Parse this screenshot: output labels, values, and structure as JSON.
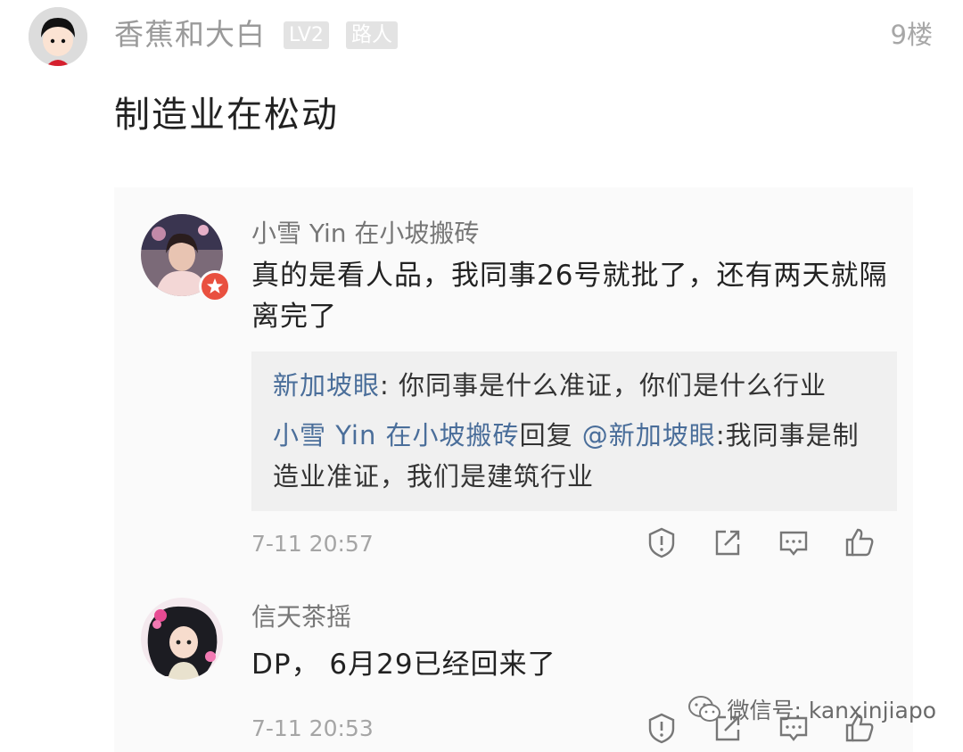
{
  "post": {
    "username": "香蕉和大白",
    "level_badge": "LV2",
    "role_badge": "路人",
    "floor": "9楼",
    "body": "制造业在松动"
  },
  "comments": [
    {
      "author": "小雪 Yin 在小坡搬砖",
      "text": "真的是看人品，我同事26号就批了，还有两天就隔离完了",
      "quote": {
        "line1_author": "新加坡眼",
        "line1_text": ": 你同事是什么准证，你们是什么行业",
        "line2_author": "小雪 Yin 在小坡搬砖",
        "line2_verb": "回复",
        "line2_mention": "@新加坡眼",
        "line2_text": ":我同事是制",
        "line3_text": "造业准证，我们是建筑行业"
      },
      "time": "7-11 20:57"
    },
    {
      "author": "信天茶摇",
      "text": "DP， 6月29已经回来了",
      "time": "7-11 20:53"
    }
  ],
  "watermark": {
    "text": "微信号: kanxinjiapo"
  },
  "icons": {
    "report": "report-icon",
    "share": "share-icon",
    "comment": "comment-icon",
    "like": "thumbs-up-icon",
    "wechat": "wechat-icon"
  },
  "colors": {
    "link_blue": "#4a6e9a",
    "badge_gray": "#e3e3e3",
    "vip_red": "#e9503f"
  }
}
